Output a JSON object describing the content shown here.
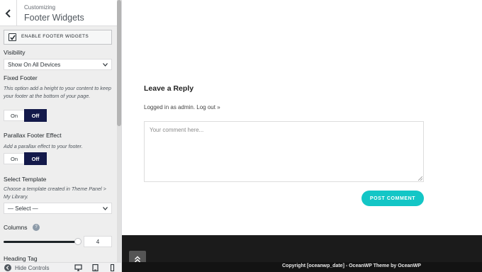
{
  "panel": {
    "header": {
      "breadcrumb": "Customizing",
      "title": "Footer Widgets"
    },
    "enable_footer": {
      "label": "ENABLE FOOTER WIDGETS",
      "checked": true
    },
    "visibility": {
      "label": "Visibility",
      "value": "Show On All Devices"
    },
    "fixed_footer": {
      "label": "Fixed Footer",
      "description": "This option add a height to your content to keep your footer at the bottom of your page.",
      "on_label": "On",
      "off_label": "Off",
      "selected": "Off"
    },
    "parallax": {
      "label": "Parallax Footer Effect",
      "description": "Add a parallax effect to your footer.",
      "on_label": "On",
      "off_label": "Off",
      "selected": "Off"
    },
    "template": {
      "label": "Select Template",
      "description": "Choose a template created in Theme Panel > My Library.",
      "value": "— Select —"
    },
    "columns": {
      "label": "Columns",
      "value": "4",
      "help_icon": "question-icon"
    },
    "next_label_partial": "Heading Tag",
    "footer": {
      "hide_label": "Hide Controls",
      "devices": [
        "desktop-icon",
        "tablet-icon",
        "mobile-icon"
      ]
    }
  },
  "preview": {
    "reply_title": "Leave a Reply",
    "logged_in": "Logged in as admin. Log out »",
    "comment_placeholder": "Your comment here...",
    "post_button": "POST COMMENT",
    "copyright": "Copyright [oceanwp_date] - OceanWP Theme by OceanWP",
    "scroll_top_icon": "double-chevron-up-icon"
  },
  "colors": {
    "accent_dark": "#13194a",
    "post_button": "#13c6c6",
    "footer_bg": "#1b1b1b"
  }
}
